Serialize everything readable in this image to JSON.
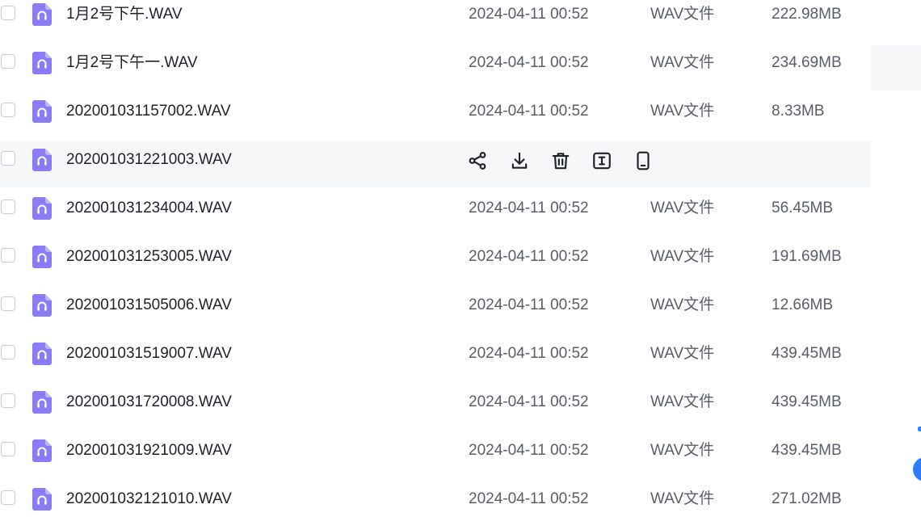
{
  "files": [
    {
      "name": "1月2号下午.WAV",
      "date": "2024-04-11 00:52",
      "type": "WAV文件",
      "size": "222.98MB"
    },
    {
      "name": "1月2号下午一.WAV",
      "date": "2024-04-11 00:52",
      "type": "WAV文件",
      "size": "234.69MB"
    },
    {
      "name": "202001031157002.WAV",
      "date": "2024-04-11 00:52",
      "type": "WAV文件",
      "size": "8.33MB"
    },
    {
      "name": "202001031221003.WAV",
      "date": "",
      "type": "",
      "size": ""
    },
    {
      "name": "202001031234004.WAV",
      "date": "2024-04-11 00:52",
      "type": "WAV文件",
      "size": "56.45MB"
    },
    {
      "name": "202001031253005.WAV",
      "date": "2024-04-11 00:52",
      "type": "WAV文件",
      "size": "191.69MB"
    },
    {
      "name": "202001031505006.WAV",
      "date": "2024-04-11 00:52",
      "type": "WAV文件",
      "size": "12.66MB"
    },
    {
      "name": "202001031519007.WAV",
      "date": "2024-04-11 00:52",
      "type": "WAV文件",
      "size": "439.45MB"
    },
    {
      "name": "202001031720008.WAV",
      "date": "2024-04-11 00:52",
      "type": "WAV文件",
      "size": "439.45MB"
    },
    {
      "name": "202001031921009.WAV",
      "date": "2024-04-11 00:52",
      "type": "WAV文件",
      "size": "439.45MB"
    },
    {
      "name": "202001032121010.WAV",
      "date": "2024-04-11 00:52",
      "type": "WAV文件",
      "size": "271.02MB"
    }
  ],
  "hovered_row": 3,
  "row_actions": [
    {
      "icon": "share-icon",
      "name": "share-button"
    },
    {
      "icon": "download-icon",
      "name": "download-button"
    },
    {
      "icon": "trash-icon",
      "name": "delete-button"
    },
    {
      "icon": "rename-icon",
      "name": "rename-button"
    },
    {
      "icon": "phone-icon",
      "name": "send-to-phone-button"
    }
  ],
  "colors": {
    "file_icon": "#8b7cf6",
    "hover_row": "#f6f7f9",
    "accent": "#2f7cf6"
  }
}
